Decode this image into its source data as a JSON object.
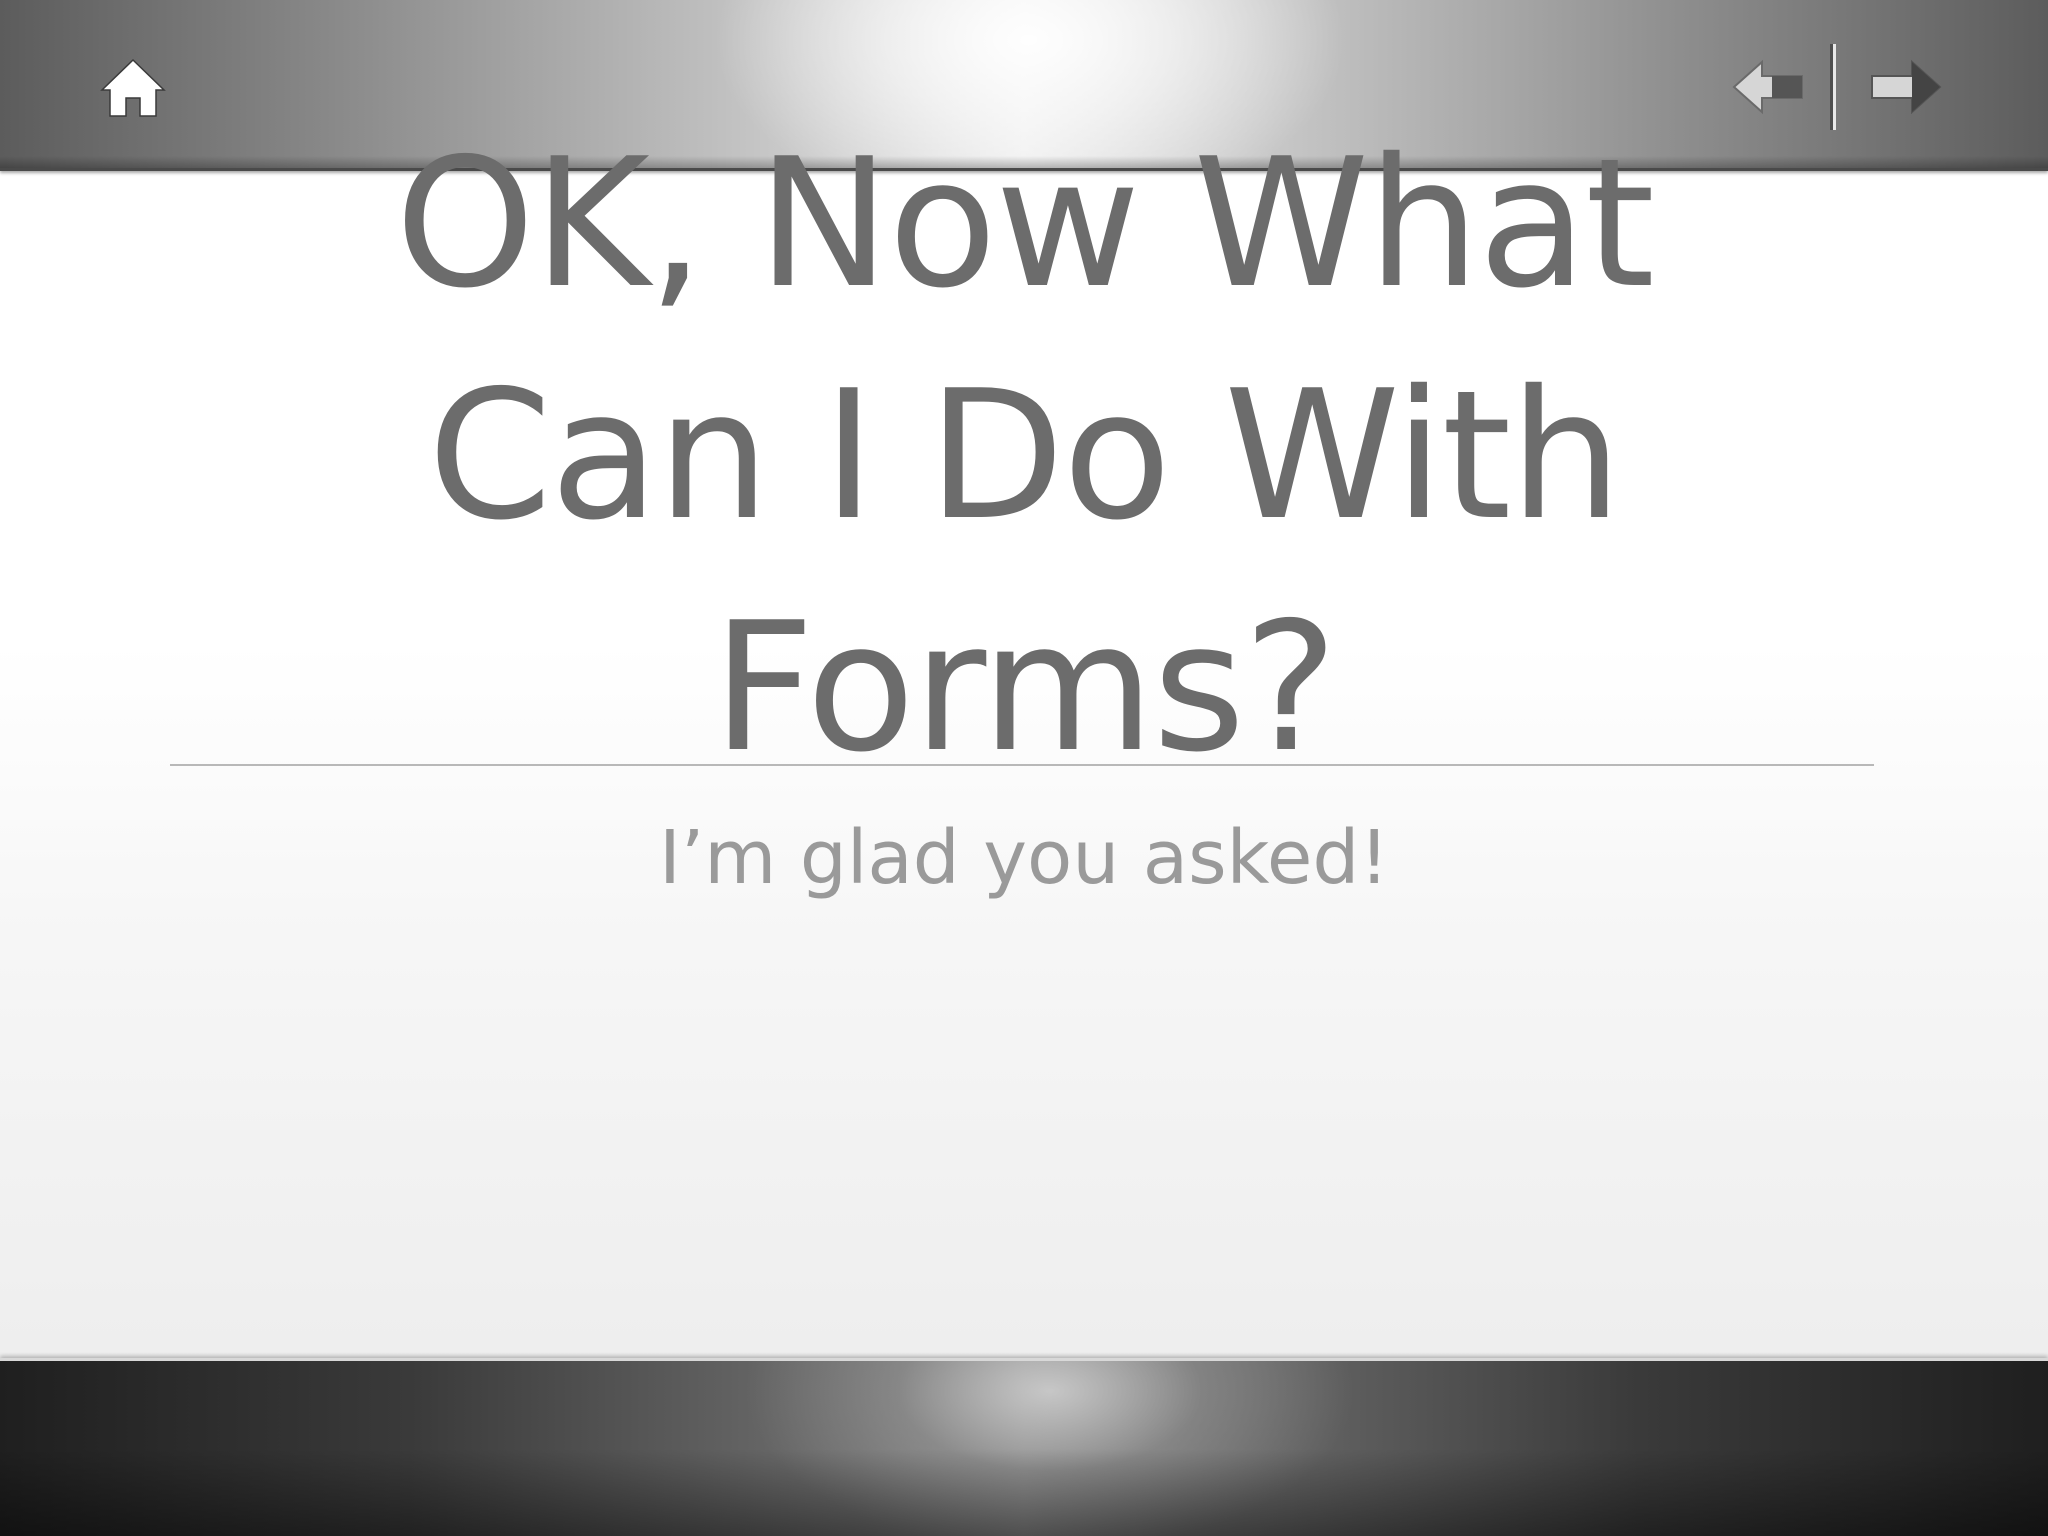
{
  "slide": {
    "title_lines": [
      "OK, Now What",
      "Can I Do With",
      "Forms?"
    ],
    "subtitle": "I’m glad you asked!"
  },
  "toolbar": {
    "home_icon": "home-icon",
    "back_icon": "arrow-left-icon",
    "forward_icon": "arrow-right-icon"
  },
  "colors": {
    "title": "#6c6c6c",
    "subtitle": "#9a9a9a",
    "rule": "#b8b8b8"
  }
}
